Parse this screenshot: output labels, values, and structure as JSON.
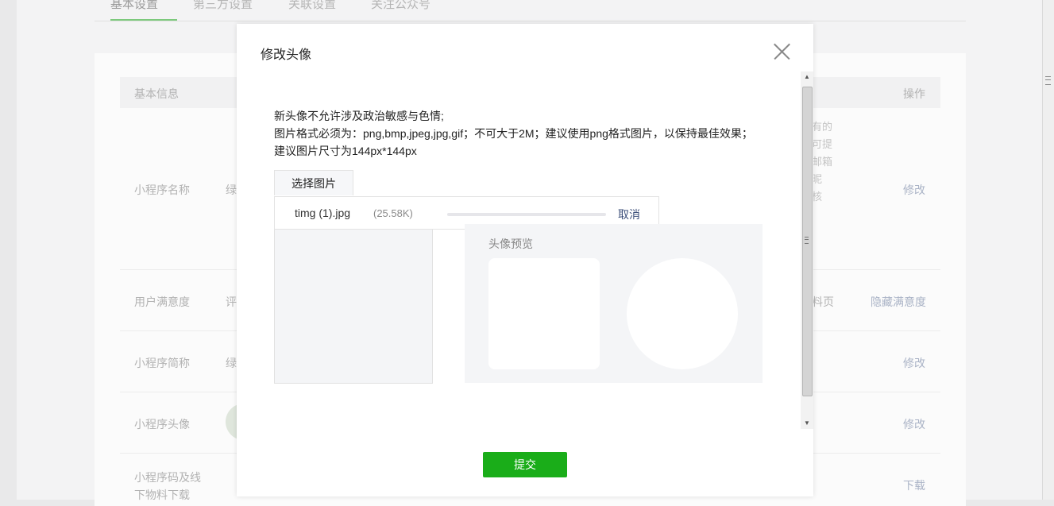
{
  "background": {
    "tabs": [
      "基本设置",
      "第三方设置",
      "关联设置",
      "关注公众号"
    ],
    "table_header": {
      "basic_info": "基本信息",
      "action": "操作"
    },
    "rows": [
      {
        "label": "小程序名称",
        "value_prefix": "绿",
        "action": "修改"
      },
      {
        "label": "用户满意度",
        "value_prefix": "评",
        "side_text": "料页",
        "action": "隐藏满意度"
      },
      {
        "label": "小程序简称",
        "value_prefix": "绿",
        "action": "修改"
      },
      {
        "label": "小程序头像",
        "action": "修改"
      },
      {
        "label": "小程序码及线下物料下载",
        "action": "下载"
      }
    ],
    "side_note_lines": [
      "有的",
      "可提",
      "邮箱",
      "昵",
      "核"
    ]
  },
  "modal": {
    "title": "修改头像",
    "desc_line1": "新头像不允许涉及政治敏感与色情;",
    "desc_line2": "图片格式必须为：png,bmp,jpeg,jpg,gif；不可大于2M；建议使用png格式图片，以保持最佳效果；建议图片尺寸为144px*144px",
    "choose_label": "选择图片",
    "upload": {
      "file_name": "timg (1).jpg",
      "file_size": "(25.58K)",
      "cancel_label": "取消",
      "progress": 0
    },
    "preview_label": "头像预览",
    "submit_label": "提交"
  },
  "colors": {
    "primary_green": "#1aad19",
    "link_blue": "#3c4f7a"
  }
}
